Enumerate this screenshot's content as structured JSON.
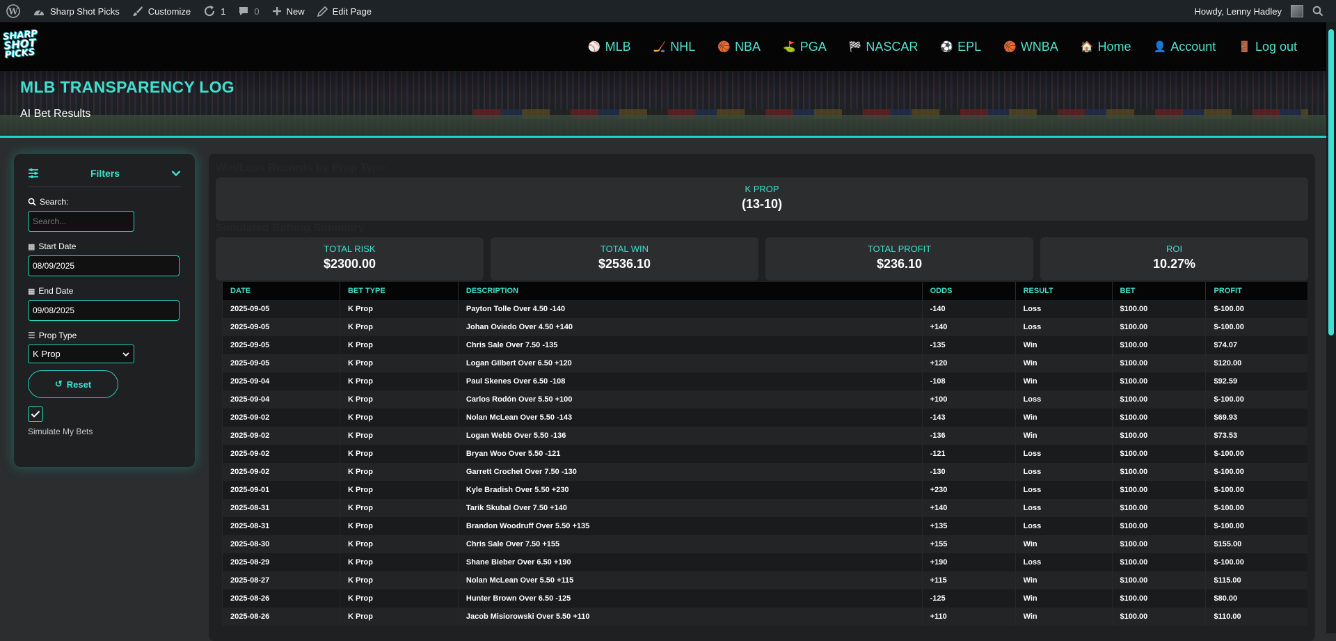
{
  "adminbar": {
    "site_name": "Sharp Shot Picks",
    "customize": "Customize",
    "updates_count": "1",
    "comments_count": "0",
    "new_label": "New",
    "edit_page": "Edit Page",
    "howdy": "Howdy, Lenny Hadley"
  },
  "logo": {
    "line1": "SHARP",
    "line2": "SHOT",
    "line3": "PICKS"
  },
  "nav": {
    "items": [
      {
        "icon": "⚾",
        "label": "MLB"
      },
      {
        "icon": "🏒",
        "label": "NHL"
      },
      {
        "icon": "🏀",
        "label": "NBA"
      },
      {
        "icon": "⛳",
        "label": "PGA"
      },
      {
        "icon": "🏁",
        "label": "NASCAR"
      },
      {
        "icon": "⚽",
        "label": "EPL"
      },
      {
        "icon": "🏀",
        "label": "WNBA"
      },
      {
        "icon": "🏠",
        "label": "Home"
      },
      {
        "icon": "👤",
        "label": "Account"
      },
      {
        "icon": "🚪",
        "label": "Log out"
      }
    ]
  },
  "hero": {
    "title": "MLB TRANSPARENCY LOG",
    "subtitle": "AI Bet Results"
  },
  "filters": {
    "title": "Filters",
    "search_label": "Search:",
    "search_placeholder": "Search...",
    "start_label": "Start Date",
    "start_value": "08/09/2025",
    "end_label": "End Date",
    "end_value": "09/08/2025",
    "prop_label": "Prop Type",
    "prop_value": "K Prop",
    "reset_label": "Reset",
    "simulate_label": "Simulate My Bets"
  },
  "records": {
    "title": "Win/Loss Records by Prop Type",
    "prop_label": "K PROP",
    "prop_record": "(13-10)"
  },
  "summary": {
    "title": "Simulated Betting Summary",
    "cards": [
      {
        "label": "TOTAL RISK",
        "value": "$2300.00"
      },
      {
        "label": "TOTAL WIN",
        "value": "$2536.10"
      },
      {
        "label": "TOTAL PROFIT",
        "value": "$236.10"
      },
      {
        "label": "ROI",
        "value": "10.27%"
      }
    ]
  },
  "table": {
    "headers": [
      "DATE",
      "BET TYPE",
      "DESCRIPTION",
      "ODDS",
      "RESULT",
      "BET",
      "PROFIT"
    ],
    "rows": [
      [
        "2025-09-05",
        "K Prop",
        "Payton Tolle Over 4.50 -140",
        "-140",
        "Loss",
        "$100.00",
        "$-100.00"
      ],
      [
        "2025-09-05",
        "K Prop",
        "Johan Oviedo Over 4.50 +140",
        "+140",
        "Loss",
        "$100.00",
        "$-100.00"
      ],
      [
        "2025-09-05",
        "K Prop",
        "Chris Sale Over 7.50 -135",
        "-135",
        "Win",
        "$100.00",
        "$74.07"
      ],
      [
        "2025-09-05",
        "K Prop",
        "Logan Gilbert Over 6.50 +120",
        "+120",
        "Win",
        "$100.00",
        "$120.00"
      ],
      [
        "2025-09-04",
        "K Prop",
        "Paul Skenes Over 6.50 -108",
        "-108",
        "Win",
        "$100.00",
        "$92.59"
      ],
      [
        "2025-09-04",
        "K Prop",
        "Carlos Rodón Over 5.50 +100",
        "+100",
        "Loss",
        "$100.00",
        "$-100.00"
      ],
      [
        "2025-09-02",
        "K Prop",
        "Nolan McLean Over 5.50 -143",
        "-143",
        "Win",
        "$100.00",
        "$69.93"
      ],
      [
        "2025-09-02",
        "K Prop",
        "Logan Webb Over 5.50 -136",
        "-136",
        "Win",
        "$100.00",
        "$73.53"
      ],
      [
        "2025-09-02",
        "K Prop",
        "Bryan Woo Over 5.50 -121",
        "-121",
        "Loss",
        "$100.00",
        "$-100.00"
      ],
      [
        "2025-09-02",
        "K Prop",
        "Garrett Crochet Over 7.50 -130",
        "-130",
        "Loss",
        "$100.00",
        "$-100.00"
      ],
      [
        "2025-09-01",
        "K Prop",
        "Kyle Bradish Over 5.50 +230",
        "+230",
        "Loss",
        "$100.00",
        "$-100.00"
      ],
      [
        "2025-08-31",
        "K Prop",
        "Tarik Skubal Over 7.50 +140",
        "+140",
        "Loss",
        "$100.00",
        "$-100.00"
      ],
      [
        "2025-08-31",
        "K Prop",
        "Brandon Woodruff Over 5.50 +135",
        "+135",
        "Loss",
        "$100.00",
        "$-100.00"
      ],
      [
        "2025-08-30",
        "K Prop",
        "Chris Sale Over 7.50 +155",
        "+155",
        "Win",
        "$100.00",
        "$155.00"
      ],
      [
        "2025-08-29",
        "K Prop",
        "Shane Bieber Over 6.50 +190",
        "+190",
        "Loss",
        "$100.00",
        "$-100.00"
      ],
      [
        "2025-08-27",
        "K Prop",
        "Nolan McLean Over 5.50 +115",
        "+115",
        "Win",
        "$100.00",
        "$115.00"
      ],
      [
        "2025-08-26",
        "K Prop",
        "Hunter Brown Over 6.50 -125",
        "-125",
        "Win",
        "$100.00",
        "$80.00"
      ],
      [
        "2025-08-26",
        "K Prop",
        "Jacob Misiorowski Over 5.50 +110",
        "+110",
        "Win",
        "$100.00",
        "$110.00"
      ]
    ]
  }
}
